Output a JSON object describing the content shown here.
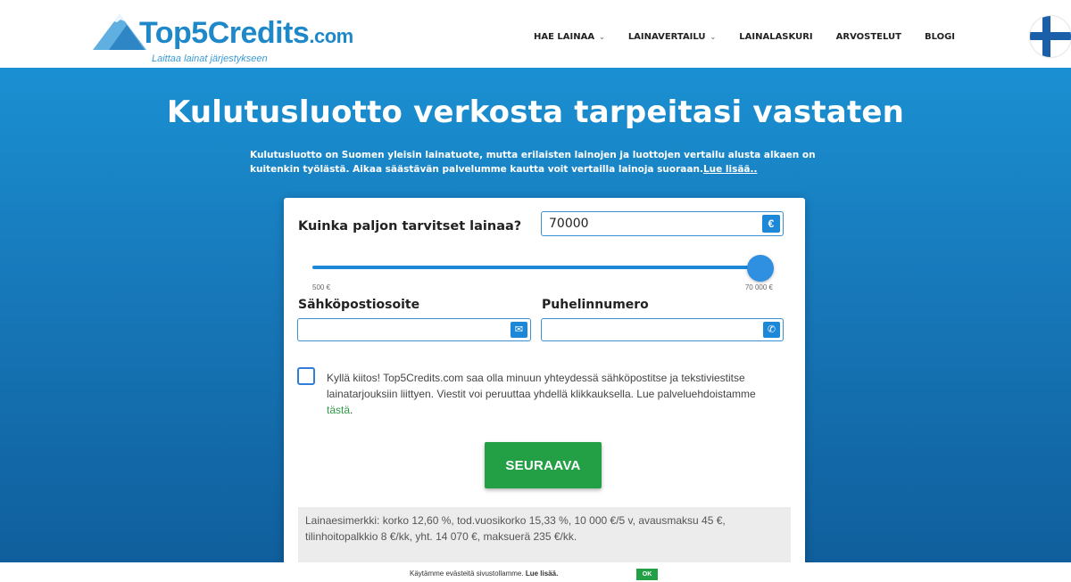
{
  "header": {
    "logo_text": "Top5Credits",
    "logo_suffix": ".com",
    "tagline": "Laittaa lainat järjestykseen",
    "nav": [
      {
        "label": "HAE LAINAA",
        "has_dropdown": true
      },
      {
        "label": "LAINAVERTAILU",
        "has_dropdown": true
      },
      {
        "label": "LAINALASKURI",
        "has_dropdown": false
      },
      {
        "label": "ARVOSTELUT",
        "has_dropdown": false
      },
      {
        "label": "BLOGI",
        "has_dropdown": false
      }
    ],
    "flag_icon": "finland-flag-icon"
  },
  "hero": {
    "title": "Kulutusluotto verkosta tarpeitasi vastaten",
    "description": "Kulutusluotto on Suomen yleisin lainatuote, mutta erilaisten lainojen ja luottojen vertailu alusta alkaen on kuitenkin työlästä. Aikaa säästävän palvelumme kautta voit vertailla lainoja suoraan.",
    "read_more": "Lue lisää.."
  },
  "form": {
    "amount_question": "Kuinka paljon tarvitset lainaa?",
    "amount_value": "70000",
    "currency_symbol": "€",
    "slider_min_label": "500 €",
    "slider_max_label": "70 000 €",
    "slider_level_percent": 100,
    "email_label": "Sähköpostiosoite",
    "email_value": "",
    "email_icon": "email-icon",
    "phone_label": "Puhelinnumero",
    "phone_value": "",
    "phone_icon": "phone-icon",
    "consent_text": "Kyllä kiitos! Top5Credits.com saa olla minuun yhteydessä sähköpostitse ja tekstiviestitse lainatarjouksiin liittyen. Viestit voi peruuttaa yhdellä klikkauksella. Lue palveluehdoistamme",
    "consent_link": "tästä",
    "consent_checked": false,
    "next_button": "SEURAAVA",
    "loan_example": "Lainaesimerkki: korko 12,60 %, tod.vuosikorko 15,33 %, 10 000 €/5 v, avausmaksu 45 €, tilinhoitopalkkio 8 €/kk, yht. 14 070 €, maksuerä 235 €/kk."
  },
  "cookie_bar": {
    "text": "Käytämme evästeitä sivustollamme.",
    "read_more": "Lue lisää.",
    "ok": "OK"
  },
  "colors": {
    "brand_blue": "#1e88c8",
    "hero_blue": "#1777b8",
    "button_green": "#23a046"
  }
}
